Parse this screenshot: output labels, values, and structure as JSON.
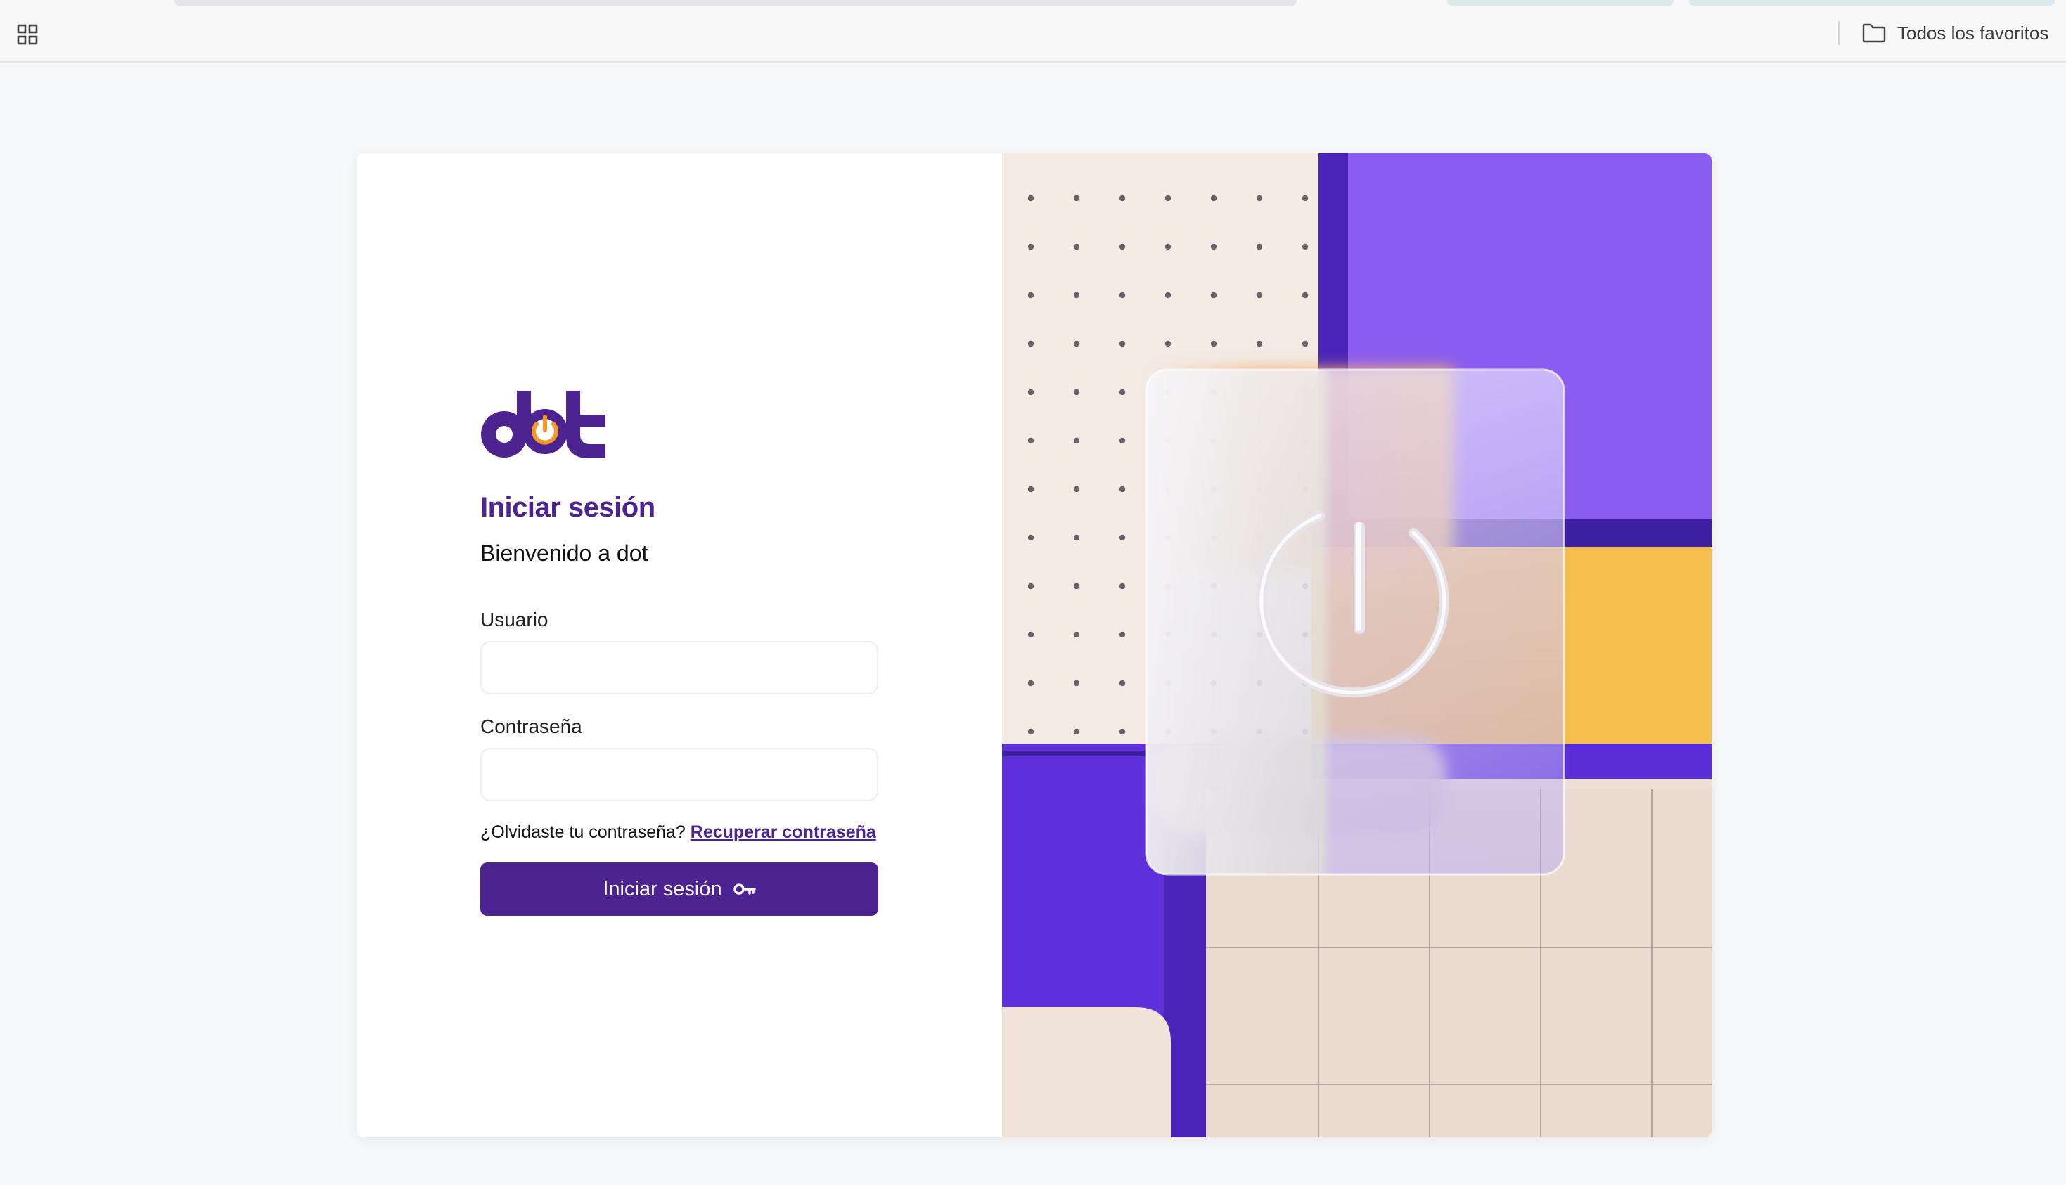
{
  "browser": {
    "bookmarks_bar": {
      "apps_icon": "grid-icon",
      "favorites_icon": "folder-icon",
      "favorites_label": "Todos los favoritos"
    }
  },
  "login": {
    "logo_text": "dot",
    "title": "Iniciar sesión",
    "subtitle": "Bienvenido a dot",
    "username": {
      "label": "Usuario",
      "value": "",
      "placeholder": ""
    },
    "password": {
      "label": "Contraseña",
      "value": "",
      "placeholder": ""
    },
    "forgot": {
      "question": "¿Olvidaste tu contraseña?",
      "link": "Recuperar contraseña"
    },
    "submit": {
      "label": "Iniciar sesión",
      "icon": "key-icon"
    }
  },
  "illustration": {
    "icon": "power-icon"
  },
  "colors": {
    "brand_purple": "#4c2391",
    "accent_orange": "#f39a26",
    "violet": "#8a5cf0",
    "deep_violet": "#5a2ed6",
    "yellow": "#f4c148",
    "cream": "#efe3da"
  }
}
